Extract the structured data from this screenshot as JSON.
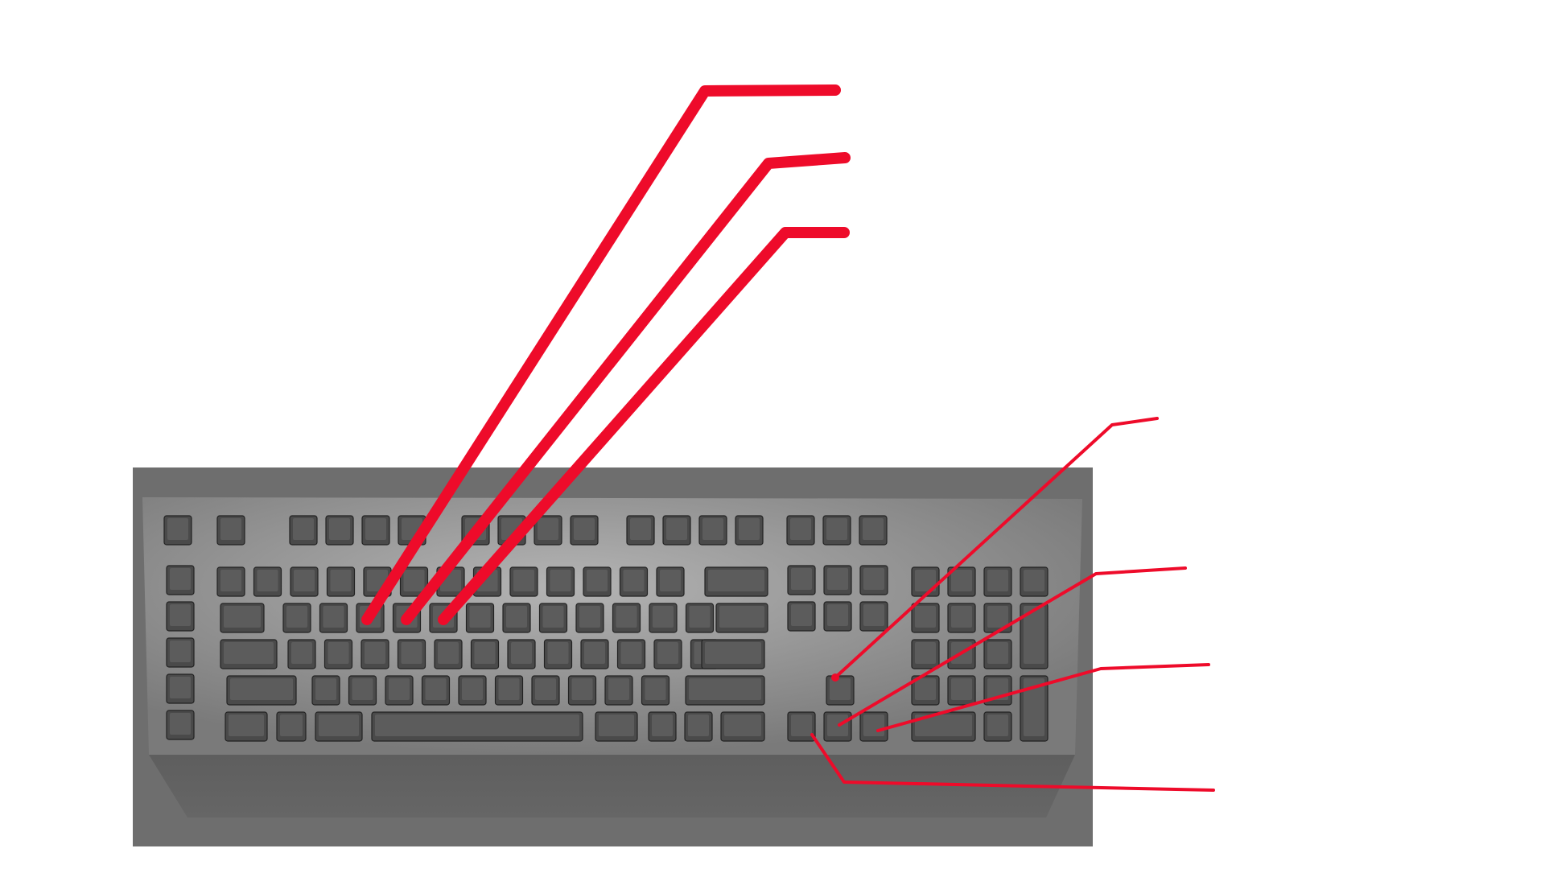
{
  "diagram": {
    "subject": "keyboard",
    "callout_labels": [],
    "colors": {
      "background": "#ffffff",
      "keyboard_body": "#6e6e6e",
      "keyboard_plate": "#9a9a9a",
      "key_cap": "#4a4a4a",
      "key_top": "#5c5c5c",
      "key_outline": "#222222",
      "leader_lines": "#ee0b2a"
    }
  }
}
